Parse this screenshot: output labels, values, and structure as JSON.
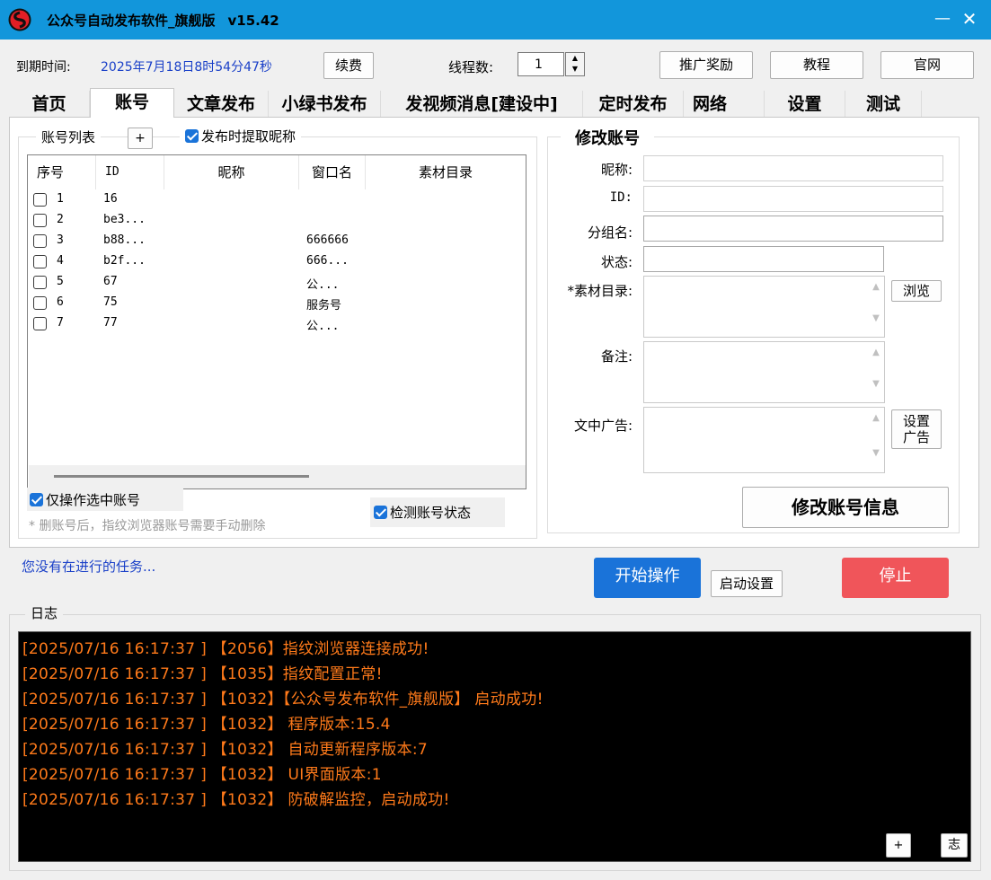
{
  "window": {
    "title": "公众号自动发布软件_旗舰版",
    "version": "v15.42",
    "minimize": "—",
    "close": "✕"
  },
  "topbar": {
    "expire_label": "到期时间:",
    "expire_value": "2025年7月18日8时54分47秒",
    "renew_button": "续费",
    "threads_label": "线程数:",
    "threads_value": "1",
    "promo_button": "推广奖励",
    "tutorial_button": "教程",
    "website_button": "官网"
  },
  "tabs": [
    "首页",
    "账号",
    "文章发布",
    "小绿书发布",
    "发视频消息[建设中]",
    "定时发布",
    "网络",
    "设置",
    "测试"
  ],
  "active_tab": "账号",
  "accounts": {
    "group_title": "账号列表",
    "add_button": "+",
    "fetch_nickname_label": "发布时提取昵称",
    "columns": [
      "序号",
      "ID",
      "昵称",
      "窗口名",
      "素材目录"
    ],
    "rows": [
      {
        "no": "1",
        "id": "16",
        "nickname": "",
        "window": "",
        "dir": ""
      },
      {
        "no": "2",
        "id": "be3...",
        "nickname": "",
        "window": "",
        "dir": ""
      },
      {
        "no": "3",
        "id": "b88...",
        "nickname": "",
        "window": "666666",
        "dir": ""
      },
      {
        "no": "4",
        "id": "b2f...",
        "nickname": "",
        "window": "666...",
        "dir": ""
      },
      {
        "no": "5",
        "id": "67",
        "nickname": "",
        "window": "公...",
        "dir": ""
      },
      {
        "no": "6",
        "id": "75",
        "nickname": "",
        "window": "服务号",
        "dir": ""
      },
      {
        "no": "7",
        "id": "77",
        "nickname": "",
        "window": "公...",
        "dir": ""
      }
    ],
    "only_selected_label": "仅操作选中账号",
    "delete_note": "* 删账号后，指纹浏览器账号需要手动删除",
    "check_status_label": "检测账号状态"
  },
  "edit": {
    "group_title": "修改账号",
    "nickname_label": "昵称:",
    "id_label": "ID:",
    "group_label": "分组名:",
    "status_label": "状态:",
    "material_label": "*素材目录:",
    "browse_button": "浏览",
    "remark_label": "备注:",
    "ad_label": "文中广告:",
    "set_ad_button": "设置广告",
    "submit_button": "修改账号信息"
  },
  "status": {
    "task_text": "您没有在进行的任务..."
  },
  "actions": {
    "start_button": "开始操作",
    "startup_settings_button": "启动设置",
    "stop_button": "停止"
  },
  "log": {
    "title": "日志",
    "lines": [
      "[2025/07/16 16:17:37 ] 【2056】指纹浏览器连接成功!",
      "[2025/07/16 16:17:37 ] 【1035】指纹配置正常!",
      "[2025/07/16 16:17:37 ] 【1032】【公众号发布软件_旗舰版】 启动成功!",
      "[2025/07/16 16:17:37 ] 【1032】 程序版本:15.4",
      "[2025/07/16 16:17:37 ] 【1032】 自动更新程序版本:7",
      "[2025/07/16 16:17:37 ] 【1032】 UI界面版本:1",
      "[2025/07/16 16:17:37 ] 【1032】 防破解监控，启动成功!"
    ],
    "plus_button": "+",
    "log_button": "志"
  },
  "colors": {
    "titlebar": "#1296db",
    "start": "#1a73d9",
    "stop": "#f0555a",
    "log_text": "#ff7a1a",
    "blue_text": "#1a40c8"
  }
}
